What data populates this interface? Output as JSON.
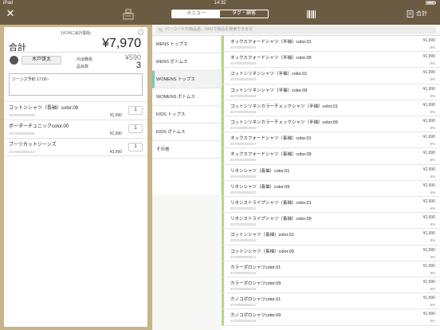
{
  "status": {
    "device": "iPad",
    "time": "14:32",
    "battery": ""
  },
  "toolbar": {
    "tabs": [
      {
        "label": "メニュー",
        "active": true
      },
      {
        "label": "タグ・顧客",
        "active": false
      }
    ],
    "total_label": "合計"
  },
  "receipt": {
    "start_time": "14:24に会計開始",
    "total_label": "合計",
    "total_value": "¥7,970",
    "customer_name": "木戸啓太",
    "tax_label": "内消費税",
    "tax_value": "¥590",
    "count_label": "品目数",
    "count_value": "3",
    "memo": "ジーンズ予約 17:00~",
    "items": [
      {
        "name": "コットンシャツ（長袖）color.09",
        "code": "4570000000009",
        "price": "¥1,990",
        "qty": "1"
      },
      {
        "name": "ボーダーチュニックcolor.00",
        "code": "4570000000085",
        "price": "¥1,990",
        "qty": "1"
      },
      {
        "name": "ブーツカットジーンズ",
        "code": "4570000000112",
        "price": "¥3,990",
        "qty": "1"
      }
    ]
  },
  "search": {
    "placeholder": "バーコードや商品名、SKUで商品を検索できます"
  },
  "categories": [
    {
      "label": "MENS トップス"
    },
    {
      "label": "MENS ボトムス"
    },
    {
      "label": "WOMENS トップス",
      "active": true
    },
    {
      "label": "WOMENS ボトムス"
    },
    {
      "label": "KIDS トップス"
    },
    {
      "label": "KIDS ボトムス"
    },
    {
      "label": "その他"
    }
  ],
  "products": [
    {
      "name": "オックスフォードシャツ（半袖）color.01",
      "code": "4570000000001",
      "price": "¥1,990",
      "tax": "8%"
    },
    {
      "name": "オックスフォードシャツ（半袖）color.09",
      "code": "4570000000002",
      "price": "¥1,990",
      "tax": "8%"
    },
    {
      "name": "コットンリネンシャツ（半袖）color.01",
      "code": "4570000000003",
      "price": "¥1,990",
      "tax": "8%"
    },
    {
      "name": "コットンリネンシャツ（半袖）color.09",
      "code": "4570000000004",
      "price": "¥1,990",
      "tax": "8%"
    },
    {
      "name": "コットンリネンカラーチェックシャツ（半袖）color.01",
      "code": "4570000000005",
      "price": "¥1,990",
      "tax": "8%"
    },
    {
      "name": "コットンリネンカラーチェックシャツ（半袖）color.09",
      "code": "4570000000006",
      "price": "¥1,990",
      "tax": "8%"
    },
    {
      "name": "オックスフォードシャツ（長袖）color.01",
      "code": "4570000000007",
      "price": "¥1,990",
      "tax": "8%"
    },
    {
      "name": "オックスフォードシャツ（長袖）color.09",
      "code": "4570000000008",
      "price": "¥1,990",
      "tax": "8%"
    },
    {
      "name": "リネンシャツ（長袖）color.01",
      "code": "4570000000009",
      "price": "¥2,990",
      "tax": "8%"
    },
    {
      "name": "リネンシャツ（長袖）color.09",
      "code": "4570000000010",
      "price": "¥2,990",
      "tax": "8%"
    },
    {
      "name": "リネンストライプシャツ（長袖）color.01",
      "code": "4570000000011",
      "price": "¥2,990",
      "tax": "8%"
    },
    {
      "name": "リネンストライプシャツ（長袖）color.09",
      "code": "4570000000012",
      "price": "¥2,990",
      "tax": "8%"
    },
    {
      "name": "コットンシャツ（長袖）color.01",
      "code": "4570000000013",
      "price": "¥1,990",
      "tax": "8%"
    },
    {
      "name": "コットンシャツ（長袖）color.09",
      "code": "4570000000014",
      "price": "¥1,990",
      "tax": "8%"
    },
    {
      "name": "カラーポロシャツcolor.01",
      "code": "4570000000015",
      "price": "¥1,990",
      "tax": "8%"
    },
    {
      "name": "カラーポロシャツcolor.09",
      "code": "4570000000016",
      "price": "¥1,990",
      "tax": "8%"
    },
    {
      "name": "カノコポロシャツcolor.01",
      "code": "4570000000017",
      "price": "¥1,990",
      "tax": "8%"
    },
    {
      "name": "カノコポロシャツcolor.09",
      "code": "4570000000018",
      "price": "¥1,990",
      "tax": "8%"
    }
  ],
  "colors": {
    "bar": "#6b5b43",
    "side": "#c9b48a",
    "accent": "#7fc7b5",
    "product_bar": "#b6d982"
  }
}
